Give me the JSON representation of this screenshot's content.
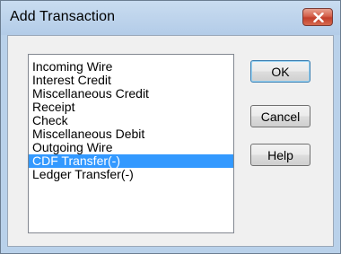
{
  "window": {
    "title": "Add Transaction"
  },
  "transactions": {
    "items": [
      "Incoming Wire",
      "Interest Credit",
      "Miscellaneous Credit",
      "Receipt",
      "Check",
      "Miscellaneous Debit",
      "Outgoing Wire",
      "CDF Transfer(-)",
      "Ledger Transfer(-)"
    ],
    "selected": "CDF Transfer(-)"
  },
  "buttons": {
    "ok": "OK",
    "cancel": "Cancel",
    "help": "Help"
  },
  "colors": {
    "selection": "#3399ff",
    "close_button": "#c23e2a"
  }
}
